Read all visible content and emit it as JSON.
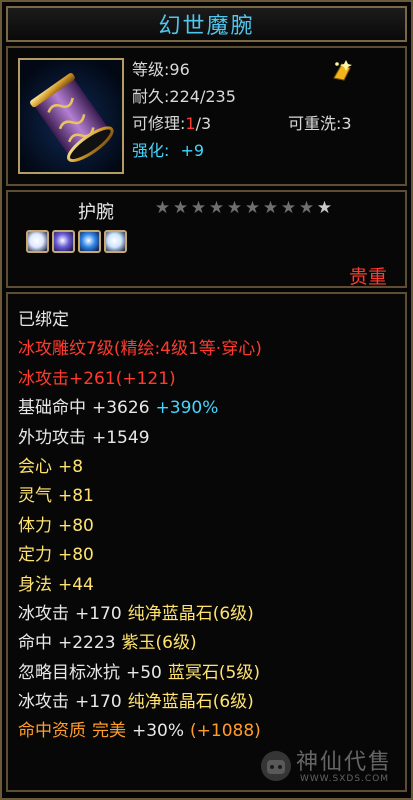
{
  "item": {
    "name": "幻世魔腕",
    "level_label": "等级",
    "level_value": ":96",
    "durability_label": "耐久",
    "durability_value": ":224/235",
    "repair_label": "可修理",
    "repair_colon": ":",
    "repair_current": "1",
    "repair_total": "/3",
    "rewash_label": "可重洗",
    "rewash_value": ":3",
    "enhance_label": "强化:",
    "enhance_value": "+9",
    "type": "护腕",
    "stars_total": 10,
    "stars_active": 1,
    "gems": [
      {
        "name": "gem-1",
        "color": "#dfe8ff"
      },
      {
        "name": "gem-2",
        "color": "#6a5bd6"
      },
      {
        "name": "gem-3",
        "color": "#2f86e8"
      },
      {
        "name": "gem-4",
        "color": "#cde6ff"
      }
    ],
    "quality": "贵重"
  },
  "attributes": [
    {
      "segments": [
        {
          "text": "已绑定",
          "color": "white"
        }
      ]
    },
    {
      "segments": [
        {
          "text": "冰攻雕纹7级(精绘:4级1等·穿心)",
          "color": "red"
        }
      ]
    },
    {
      "segments": [
        {
          "text": "冰攻击+261(+121)",
          "color": "red"
        }
      ]
    },
    {
      "segments": [
        {
          "text": "基础命中",
          "color": "white"
        },
        {
          "text": "+3626",
          "color": "white"
        },
        {
          "text": "+390%",
          "color": "cyan"
        }
      ]
    },
    {
      "segments": [
        {
          "text": "外功攻击",
          "color": "white"
        },
        {
          "text": "+1549",
          "color": "white"
        }
      ]
    },
    {
      "segments": [
        {
          "text": "会心",
          "color": "yellow"
        },
        {
          "text": "+8",
          "color": "yellow"
        }
      ]
    },
    {
      "segments": [
        {
          "text": "灵气",
          "color": "yellow"
        },
        {
          "text": "+81",
          "color": "yellow"
        }
      ]
    },
    {
      "segments": [
        {
          "text": "体力",
          "color": "yellow"
        },
        {
          "text": "+80",
          "color": "yellow"
        }
      ]
    },
    {
      "segments": [
        {
          "text": "定力",
          "color": "yellow"
        },
        {
          "text": "+80",
          "color": "yellow"
        }
      ]
    },
    {
      "segments": [
        {
          "text": "身法",
          "color": "yellow"
        },
        {
          "text": "+44",
          "color": "yellow"
        }
      ]
    },
    {
      "segments": [
        {
          "text": "冰攻击",
          "color": "white"
        },
        {
          "text": "+170",
          "color": "white"
        },
        {
          "text": "纯净蓝晶石(6级)",
          "color": "yellow"
        }
      ]
    },
    {
      "segments": [
        {
          "text": "命中",
          "color": "white"
        },
        {
          "text": "+2223",
          "color": "white"
        },
        {
          "text": "紫玉(6级)",
          "color": "yellow"
        }
      ]
    },
    {
      "segments": [
        {
          "text": "忽略目标冰抗",
          "color": "white"
        },
        {
          "text": "+50",
          "color": "white"
        },
        {
          "text": "蓝冥石(5级)",
          "color": "yellow"
        }
      ]
    },
    {
      "segments": [
        {
          "text": "冰攻击",
          "color": "white"
        },
        {
          "text": "+170",
          "color": "white"
        },
        {
          "text": "纯净蓝晶石(6级)",
          "color": "yellow"
        }
      ]
    },
    {
      "segments": [
        {
          "text": "命中资质",
          "color": "orange"
        },
        {
          "text": "完美",
          "color": "orange"
        },
        {
          "text": "+30%",
          "color": "white"
        },
        {
          "text": "(+1088)",
          "color": "orange"
        }
      ]
    }
  ],
  "watermark": {
    "text": "神仙代售",
    "url": "WWW.SXDS.COM"
  }
}
